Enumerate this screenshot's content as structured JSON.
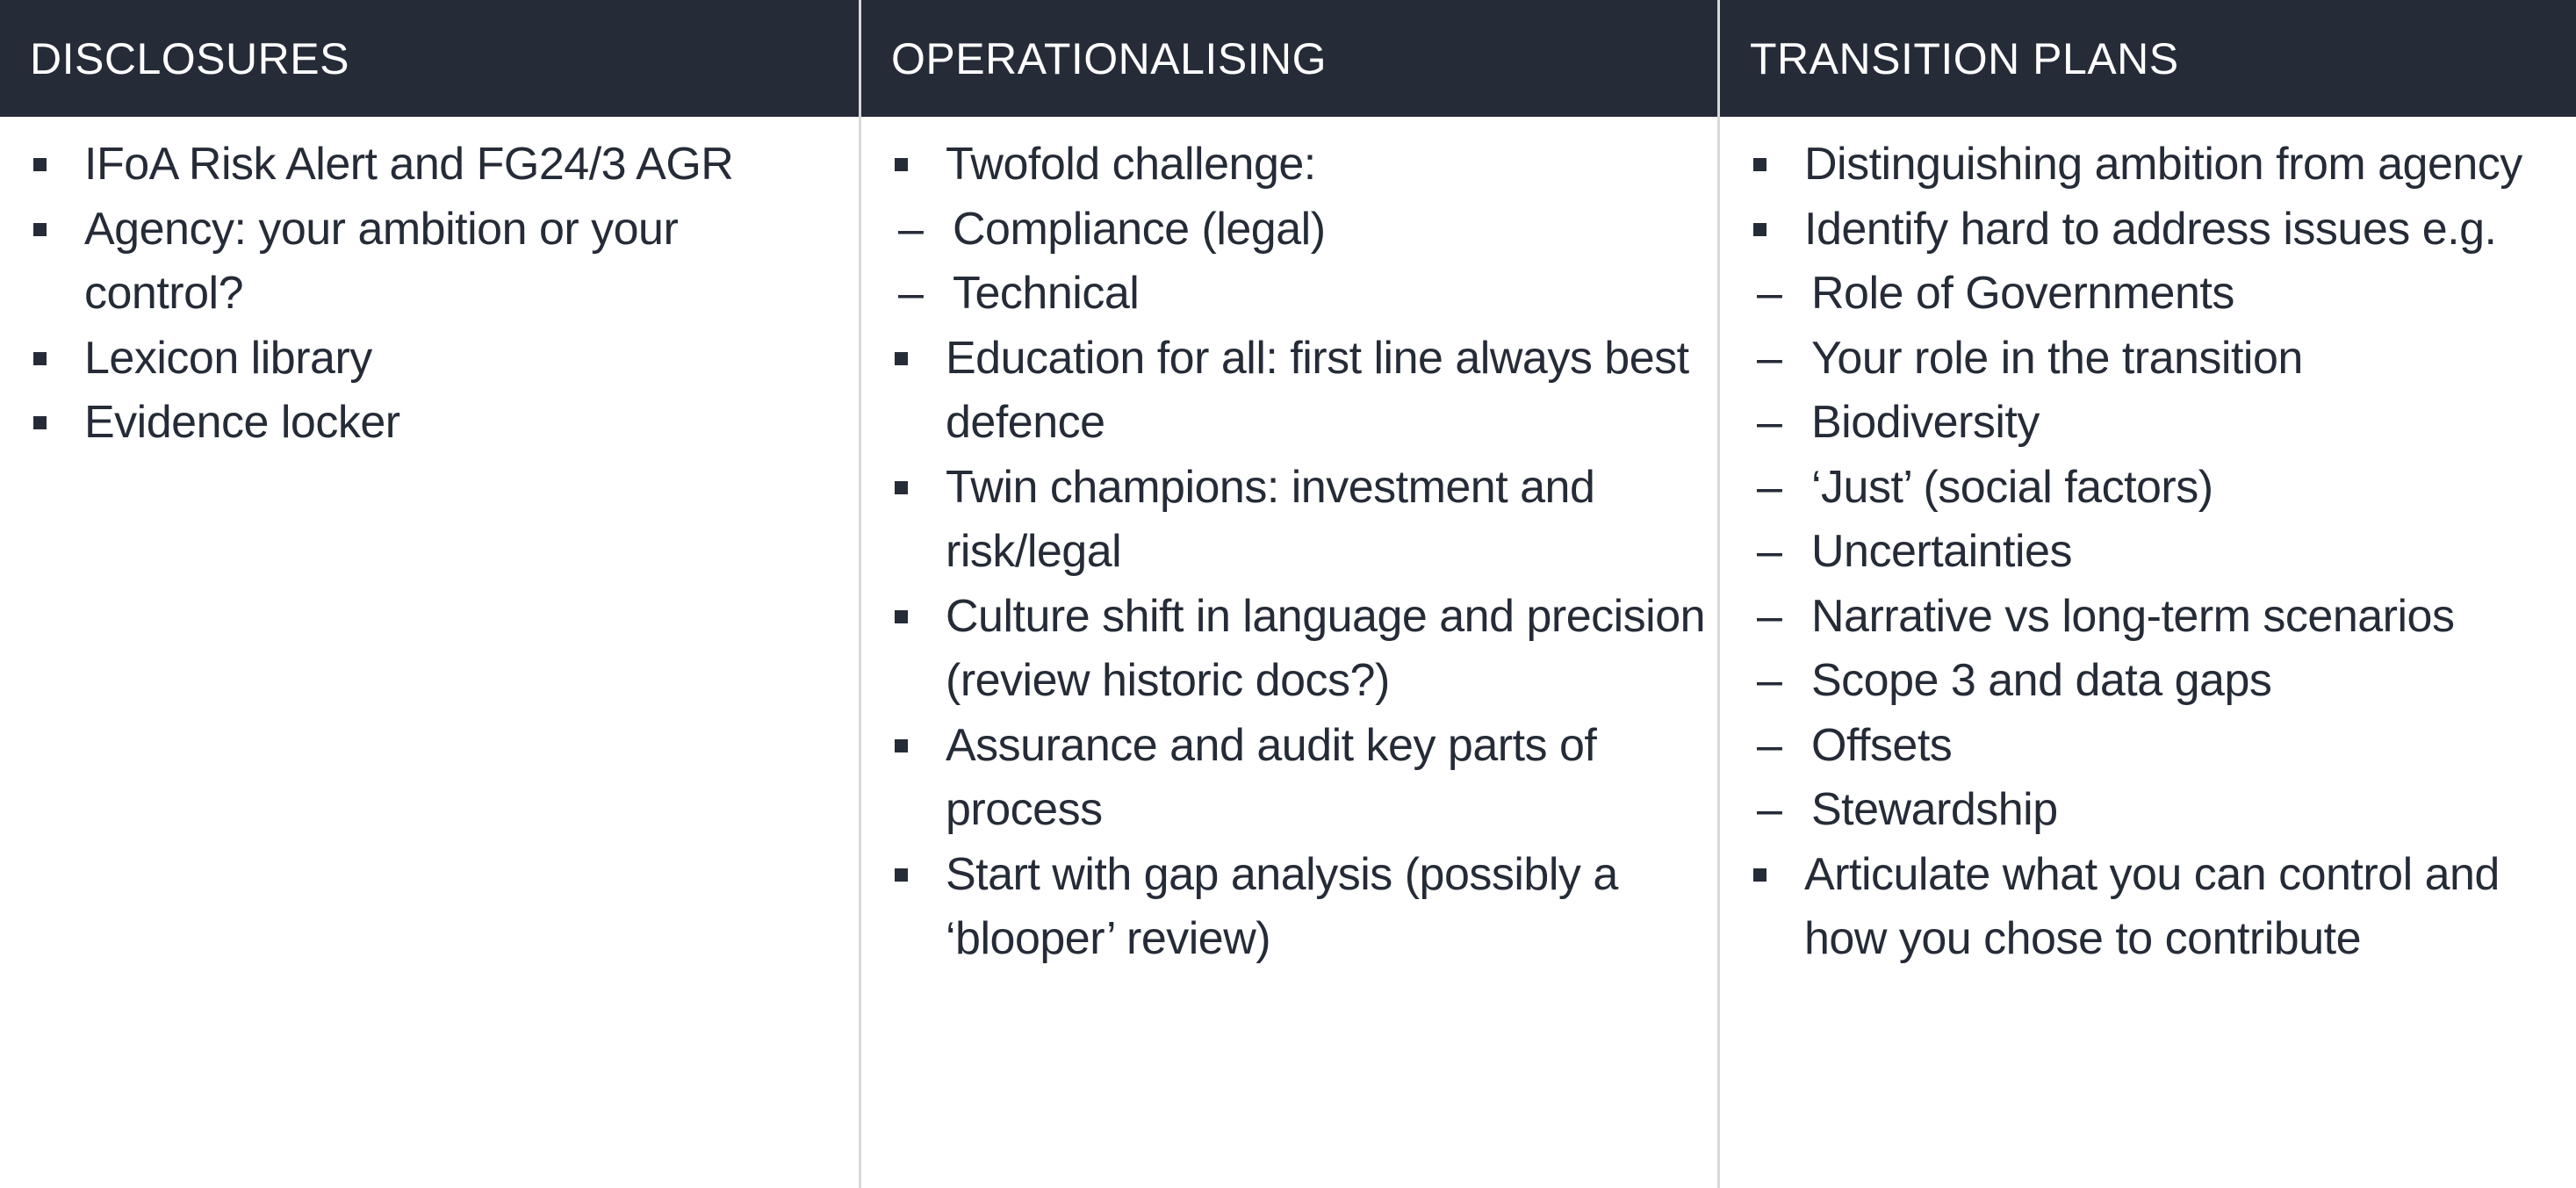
{
  "columns": [
    {
      "title": "DISCLOSURES",
      "items": [
        {
          "text": "IFoA Risk Alert and FG24/3 AGR"
        },
        {
          "text": "Agency: your ambition or your control?"
        },
        {
          "text": "Lexicon library"
        },
        {
          "text": "Evidence locker"
        }
      ]
    },
    {
      "title": "OPERATIONALISING",
      "items": [
        {
          "text": "Twofold challenge:",
          "subitems": [
            "Compliance (legal)",
            "Technical"
          ]
        },
        {
          "text": "Education for all: first line always best defence"
        },
        {
          "text": "Twin champions: investment and risk/legal"
        },
        {
          "text": "Culture shift in language and precision (review historic docs?)"
        },
        {
          "text": "Assurance and audit key parts of process"
        },
        {
          "text": "Start with gap analysis (possibly a ‘blooper’ review)"
        }
      ]
    },
    {
      "title": "TRANSITION PLANS",
      "items": [
        {
          "text": "Distinguishing ambition from agency"
        },
        {
          "text": "Identify hard to address issues e.g.",
          "subitems": [
            "Role of Governments",
            "Your role in the transition",
            "Biodiversity",
            "‘Just’ (social factors)",
            "Uncertainties",
            "Narrative vs long-term scenarios",
            "Scope 3 and data gaps",
            "Offsets",
            "Stewardship"
          ]
        },
        {
          "text": "Articulate what you can control and how you chose to contribute"
        }
      ]
    }
  ],
  "icons": {
    "bullet": "square-bullet-icon",
    "subbullet": "–"
  },
  "colors": {
    "header_bg": "#252b37",
    "header_text": "#ffffff",
    "body_text": "#252b37",
    "divider": "#d9d9d9"
  }
}
